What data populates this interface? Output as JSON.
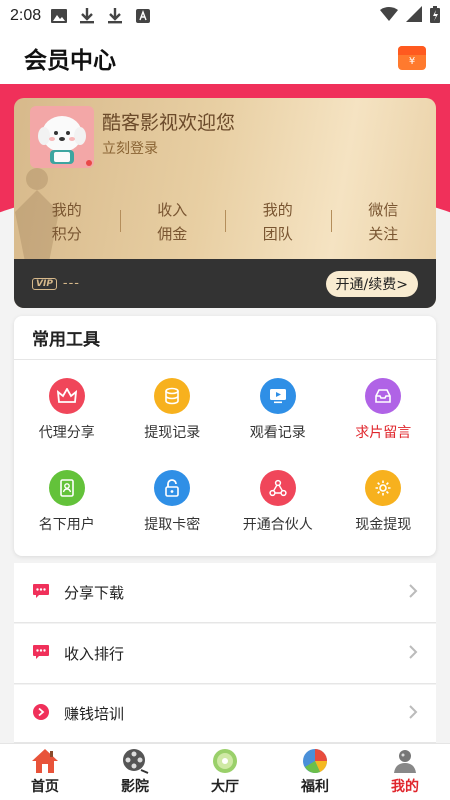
{
  "status_bar": {
    "time": "2:08"
  },
  "header": {
    "title": "会员中心",
    "wallet_symbol": "¥"
  },
  "profile": {
    "welcome": "酷客影视欢迎您",
    "login_link": "立刻登录"
  },
  "stats": [
    {
      "line1": "我的",
      "line2": "积分"
    },
    {
      "line1": "收入",
      "line2": "佣金"
    },
    {
      "line1": "我的",
      "line2": "团队"
    },
    {
      "line1": "微信",
      "line2": "关注"
    }
  ],
  "vip_bar": {
    "badge": "VIP",
    "status": "---",
    "button": "开通/续费>"
  },
  "tools": {
    "title": "常用工具",
    "items": [
      {
        "label": "代理分享",
        "icon": "crown-icon",
        "color": "#f0465a"
      },
      {
        "label": "提现记录",
        "icon": "coins-icon",
        "color": "#f7b11e"
      },
      {
        "label": "观看记录",
        "icon": "play-screen-icon",
        "color": "#2f8fe6"
      },
      {
        "label": "求片留言",
        "icon": "inbox-icon",
        "color": "#b063e6",
        "highlight": true
      },
      {
        "label": "名下用户",
        "icon": "user-card-icon",
        "color": "#63c23a"
      },
      {
        "label": "提取卡密",
        "icon": "unlock-icon",
        "color": "#2f8fe6"
      },
      {
        "label": "开通合伙人",
        "icon": "network-icon",
        "color": "#f0465a"
      },
      {
        "label": "现金提现",
        "icon": "gear-icon",
        "color": "#f7b11e"
      }
    ]
  },
  "menu": [
    {
      "label": "分享下载",
      "icon": "chat-bubble-icon"
    },
    {
      "label": "收入排行",
      "icon": "chat-bubble-icon"
    },
    {
      "label": "赚钱培训",
      "icon": "play-circle-icon"
    }
  ],
  "tabbar": {
    "active": "我的",
    "items": [
      {
        "label": "首页",
        "icon": "home-icon"
      },
      {
        "label": "影院",
        "icon": "film-reel-icon"
      },
      {
        "label": "大厅",
        "icon": "disc-icon"
      },
      {
        "label": "福利",
        "icon": "pie-icon"
      },
      {
        "label": "我的",
        "icon": "profile-icon"
      }
    ]
  },
  "colors": {
    "accent_red": "#f0305a",
    "gold": "#d7b98b",
    "active_tab": "#e0262c"
  }
}
